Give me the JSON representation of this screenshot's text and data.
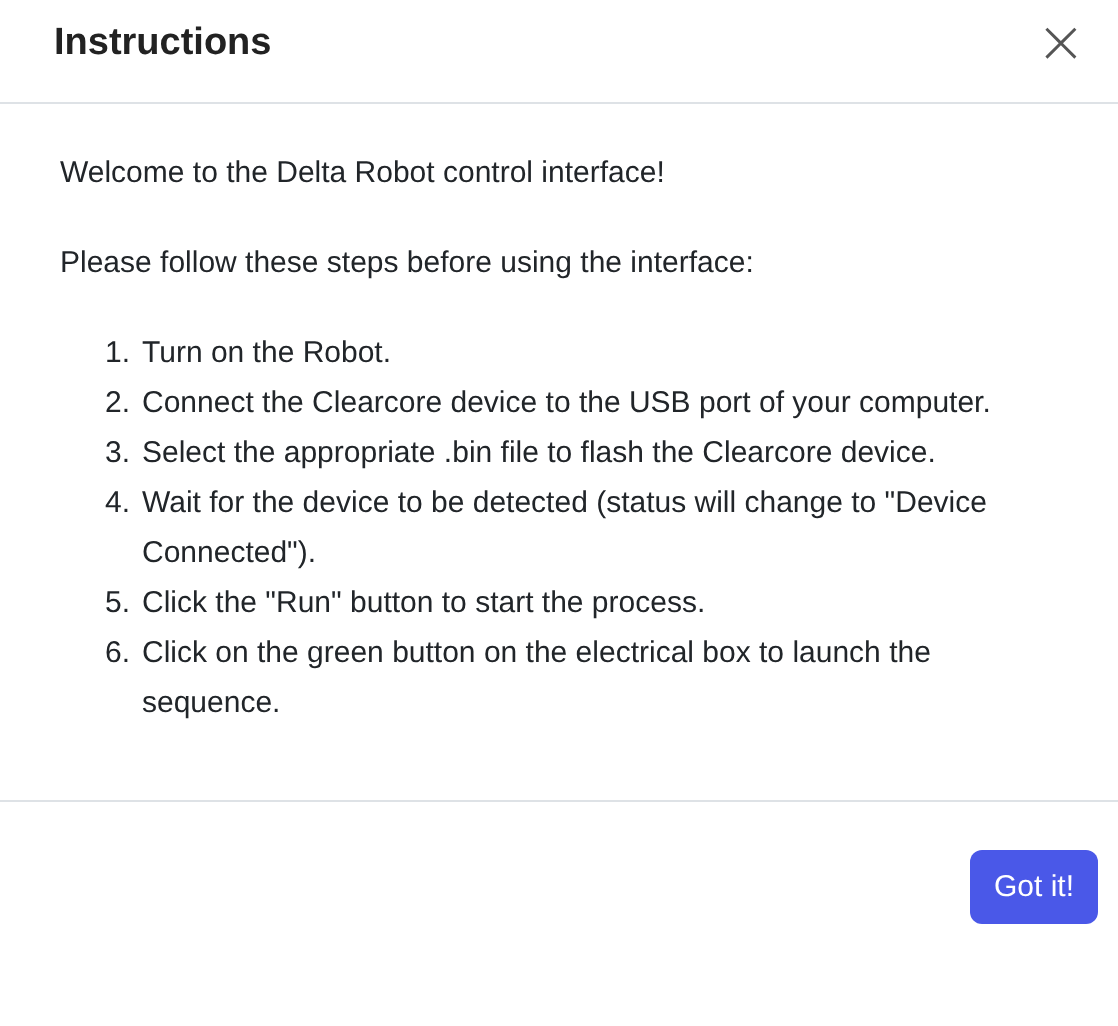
{
  "dialog": {
    "title": "Instructions",
    "close": "×",
    "intro": "Welcome to the Delta Robot control interface!",
    "lead": "Please follow these steps before using the interface:",
    "steps": [
      {
        "number": "1.",
        "text": "Turn on the Robot."
      },
      {
        "number": "2.",
        "text": "Connect the Clearcore device to the USB port of your computer."
      },
      {
        "number": "3.",
        "text": "Select the appropriate .bin file to flash the Clearcore device."
      },
      {
        "number": "4.",
        "text": "Wait for the device to be detected (status will change to \"Device Connected\")."
      },
      {
        "number": "5.",
        "text": "Click the \"Run\" button to start the process."
      },
      {
        "number": "6.",
        "text": "Click on the green button on the electrical box to launch the sequence."
      }
    ],
    "button": "Got it!"
  }
}
